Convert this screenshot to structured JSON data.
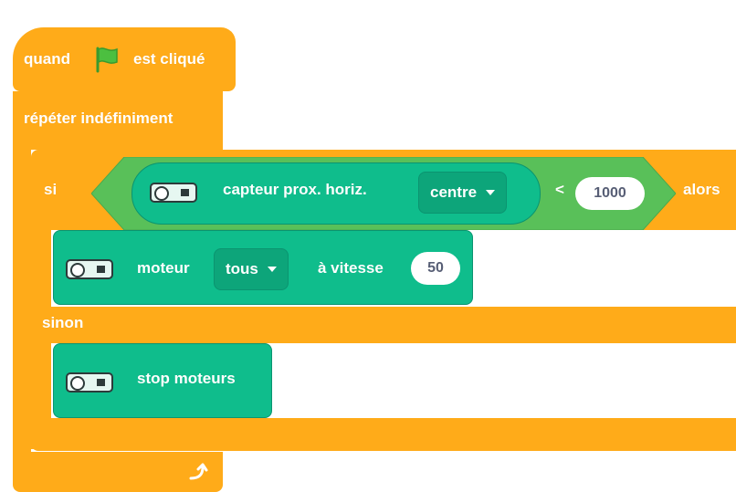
{
  "event_block": {
    "prefix": "quand",
    "flag_icon": "green-flag-icon",
    "suffix": "est cliqué"
  },
  "forever_block": {
    "label": "répéter indéfiniment"
  },
  "if_block": {
    "if_label": "si",
    "then_label": "alors",
    "else_label": "sinon"
  },
  "condition": {
    "sensor_label": "capteur prox. horiz.",
    "sensor_option": "centre",
    "operator": "<",
    "value": "1000"
  },
  "motor_block": {
    "label": "moteur",
    "motor_option": "tous",
    "speed_label": "à vitesse",
    "speed_value": "50"
  },
  "stop_block": {
    "label": "stop moteurs"
  },
  "colors": {
    "control": "#FFAB19",
    "extension": "#0FBD8C",
    "operator": "#59C059"
  }
}
